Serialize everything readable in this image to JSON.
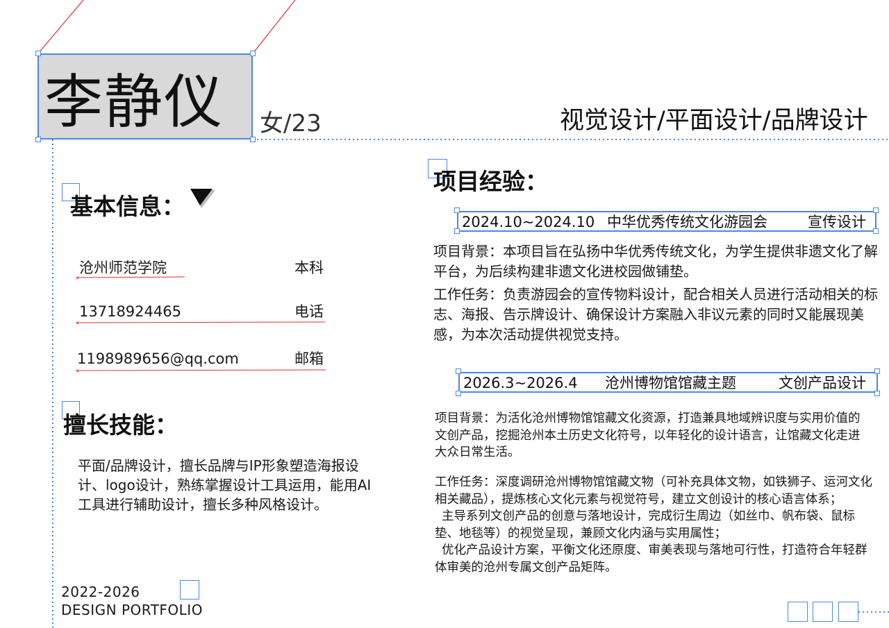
{
  "name": "李静仪",
  "gender_age": "女/23",
  "role_title": "视觉设计/平面设计/品牌设计",
  "basic_info": {
    "title": "基本信息：",
    "rows": [
      {
        "value": "沧州师范学院",
        "label": "本科"
      },
      {
        "value": "13718924465",
        "label": "电话"
      },
      {
        "value": "1198989656@qq.com",
        "label": "邮箱"
      }
    ]
  },
  "skills": {
    "title": "擅长技能：",
    "text": "平面/品牌设计，擅长品牌与IP形象塑造海报设计、logo设计，熟练掌握设计工具运用，能用AI工具进行辅助设计，擅长多种风格设计。"
  },
  "footer": {
    "years": "2022-2026",
    "label": "DESIGN PORTFOLIO"
  },
  "projects": {
    "title": "项目经验：",
    "items": [
      {
        "date": "2024.10~2024.10",
        "name": "中华优秀传统文化游园会",
        "role": "宣传设计",
        "background": "项目背景：本项目旨在弘扬中华优秀传统文化，为学生提供非遗文化了解平台，为后续构建非遗文化进校园做铺垫。",
        "tasks": "工作任务：负责游园会的宣传物料设计，配合相关人员进行活动相关的标志、海报、告示牌设计、确保设计方案融入非议元素的同时又能展现美感，为本次活动提供视觉支持。"
      },
      {
        "date": "2026.3~2026.4",
        "name": "沧州博物馆馆藏主题",
        "role": "文创产品设计",
        "background": "项目背景：为活化沧州博物馆馆藏文化资源，打造兼具地域辨识度与实用价值的文创产品，挖掘沧州本土历史文化符号，以年轻化的设计语言，让馆藏文化走进大众日常生活。",
        "tasks": [
          "工作任务：深度调研沧州博物馆馆藏文物（可补充具体文物，如铁狮子、运河文化相关藏品），提炼核心文化元素与视觉符号，建立文创设计的核心语言体系；",
          "主导系列文创产品的创意与落地设计，完成衍生周边（如丝巾、帆布袋、鼠标垫、地毯等）的视觉呈现，兼顾文化内涵与实用属性；",
          "优化产品设计方案，平衡文化还原度、审美表现与落地可行性，打造符合年轻群体审美的沧州专属文创产品矩阵。"
        ]
      }
    ]
  },
  "colors": {
    "accent_blue": "#4a86e8",
    "line_red": "#d93030",
    "name_box_bg": "#d9d9d9"
  },
  "icons": [
    "cursor-arrow-icon"
  ]
}
